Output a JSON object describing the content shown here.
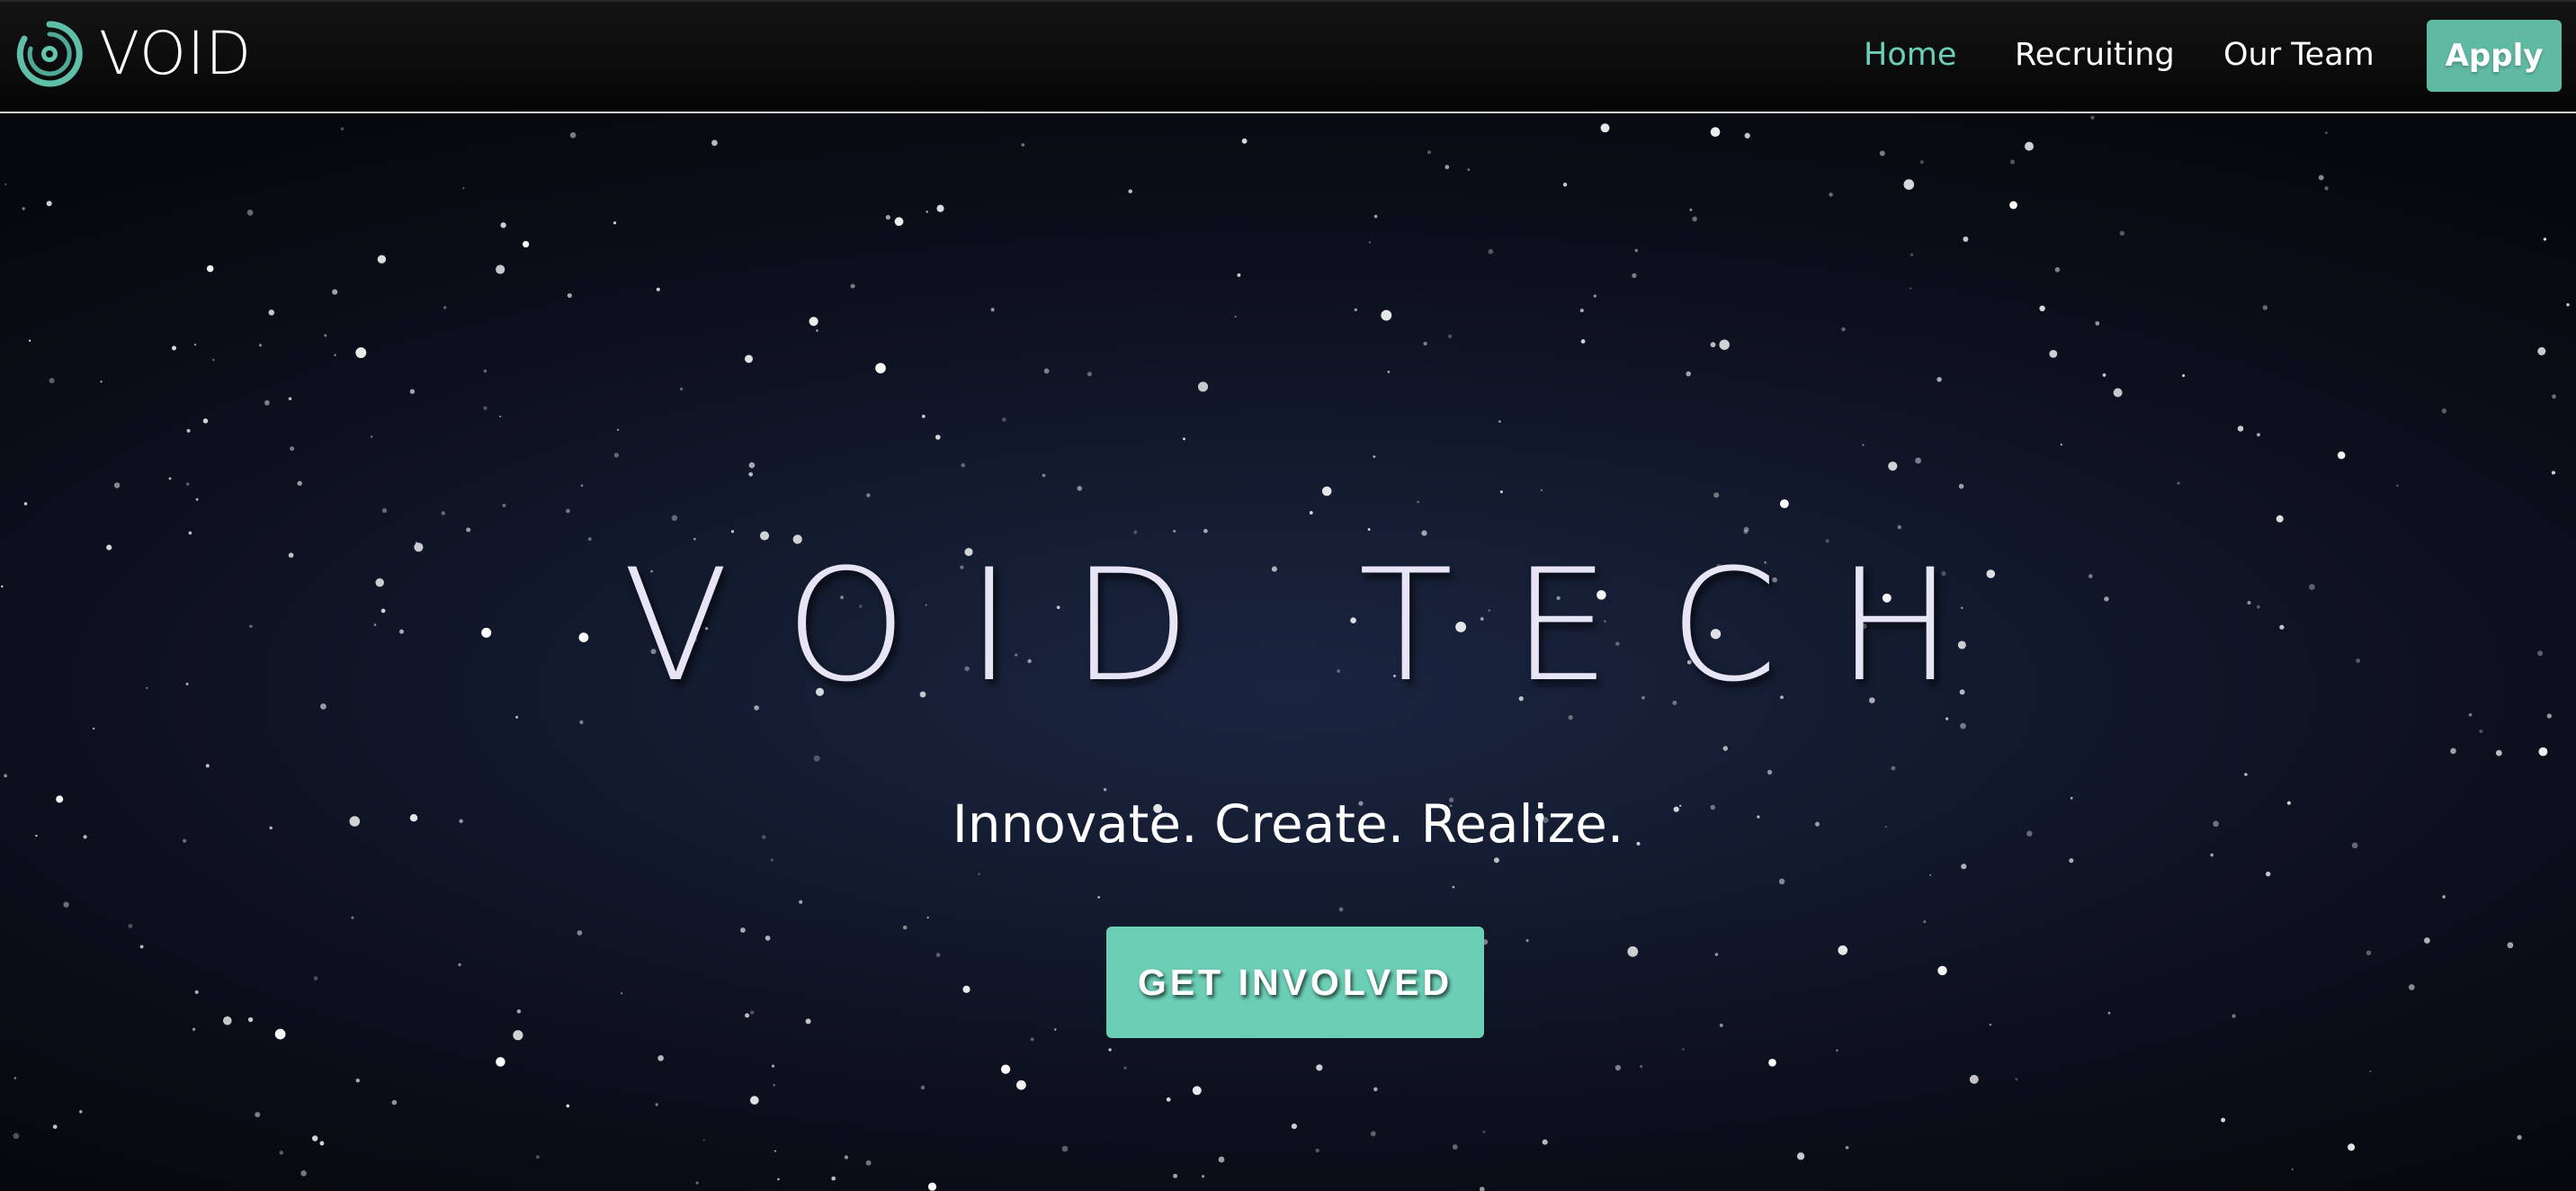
{
  "colors": {
    "accent": "#6bd0b7",
    "apply_button": "#60b9a3",
    "cta_button": "#6bcfb6",
    "title_text": "#e7e4f5",
    "background_center": "#1b2540",
    "background_edge": "#07080c"
  },
  "header": {
    "logo_icon": "void-logo-icon",
    "logo_text": "VOID",
    "nav": {
      "home": "Home",
      "recruiting": "Recruiting",
      "our_team": "Our Team"
    },
    "active_item": "home",
    "apply_label": "Apply"
  },
  "hero": {
    "title": "VOID TECH",
    "subtitle": "Innovate. Create. Realize.",
    "cta_label": "GET INVOLVED"
  }
}
